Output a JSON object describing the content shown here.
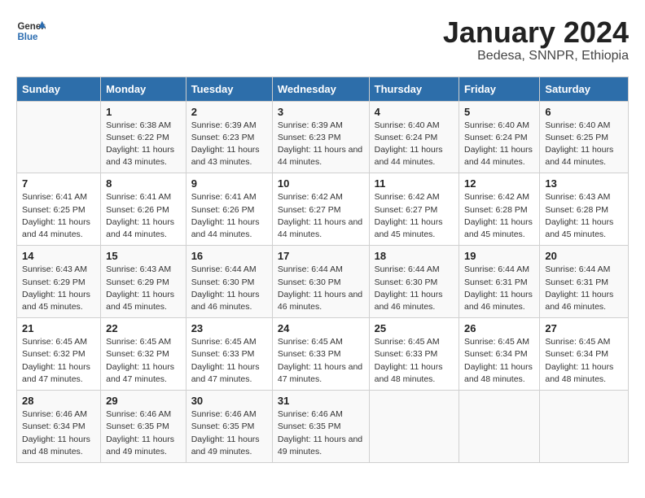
{
  "logo": {
    "text_general": "General",
    "text_blue": "Blue"
  },
  "title": "January 2024",
  "subtitle": "Bedesa, SNNPR, Ethiopia",
  "days_of_week": [
    "Sunday",
    "Monday",
    "Tuesday",
    "Wednesday",
    "Thursday",
    "Friday",
    "Saturday"
  ],
  "weeks": [
    [
      {
        "day": "",
        "sunrise": "",
        "sunset": "",
        "daylight": ""
      },
      {
        "day": "1",
        "sunrise": "Sunrise: 6:38 AM",
        "sunset": "Sunset: 6:22 PM",
        "daylight": "Daylight: 11 hours and 43 minutes."
      },
      {
        "day": "2",
        "sunrise": "Sunrise: 6:39 AM",
        "sunset": "Sunset: 6:23 PM",
        "daylight": "Daylight: 11 hours and 43 minutes."
      },
      {
        "day": "3",
        "sunrise": "Sunrise: 6:39 AM",
        "sunset": "Sunset: 6:23 PM",
        "daylight": "Daylight: 11 hours and 44 minutes."
      },
      {
        "day": "4",
        "sunrise": "Sunrise: 6:40 AM",
        "sunset": "Sunset: 6:24 PM",
        "daylight": "Daylight: 11 hours and 44 minutes."
      },
      {
        "day": "5",
        "sunrise": "Sunrise: 6:40 AM",
        "sunset": "Sunset: 6:24 PM",
        "daylight": "Daylight: 11 hours and 44 minutes."
      },
      {
        "day": "6",
        "sunrise": "Sunrise: 6:40 AM",
        "sunset": "Sunset: 6:25 PM",
        "daylight": "Daylight: 11 hours and 44 minutes."
      }
    ],
    [
      {
        "day": "7",
        "sunrise": "Sunrise: 6:41 AM",
        "sunset": "Sunset: 6:25 PM",
        "daylight": "Daylight: 11 hours and 44 minutes."
      },
      {
        "day": "8",
        "sunrise": "Sunrise: 6:41 AM",
        "sunset": "Sunset: 6:26 PM",
        "daylight": "Daylight: 11 hours and 44 minutes."
      },
      {
        "day": "9",
        "sunrise": "Sunrise: 6:41 AM",
        "sunset": "Sunset: 6:26 PM",
        "daylight": "Daylight: 11 hours and 44 minutes."
      },
      {
        "day": "10",
        "sunrise": "Sunrise: 6:42 AM",
        "sunset": "Sunset: 6:27 PM",
        "daylight": "Daylight: 11 hours and 44 minutes."
      },
      {
        "day": "11",
        "sunrise": "Sunrise: 6:42 AM",
        "sunset": "Sunset: 6:27 PM",
        "daylight": "Daylight: 11 hours and 45 minutes."
      },
      {
        "day": "12",
        "sunrise": "Sunrise: 6:42 AM",
        "sunset": "Sunset: 6:28 PM",
        "daylight": "Daylight: 11 hours and 45 minutes."
      },
      {
        "day": "13",
        "sunrise": "Sunrise: 6:43 AM",
        "sunset": "Sunset: 6:28 PM",
        "daylight": "Daylight: 11 hours and 45 minutes."
      }
    ],
    [
      {
        "day": "14",
        "sunrise": "Sunrise: 6:43 AM",
        "sunset": "Sunset: 6:29 PM",
        "daylight": "Daylight: 11 hours and 45 minutes."
      },
      {
        "day": "15",
        "sunrise": "Sunrise: 6:43 AM",
        "sunset": "Sunset: 6:29 PM",
        "daylight": "Daylight: 11 hours and 45 minutes."
      },
      {
        "day": "16",
        "sunrise": "Sunrise: 6:44 AM",
        "sunset": "Sunset: 6:30 PM",
        "daylight": "Daylight: 11 hours and 46 minutes."
      },
      {
        "day": "17",
        "sunrise": "Sunrise: 6:44 AM",
        "sunset": "Sunset: 6:30 PM",
        "daylight": "Daylight: 11 hours and 46 minutes."
      },
      {
        "day": "18",
        "sunrise": "Sunrise: 6:44 AM",
        "sunset": "Sunset: 6:30 PM",
        "daylight": "Daylight: 11 hours and 46 minutes."
      },
      {
        "day": "19",
        "sunrise": "Sunrise: 6:44 AM",
        "sunset": "Sunset: 6:31 PM",
        "daylight": "Daylight: 11 hours and 46 minutes."
      },
      {
        "day": "20",
        "sunrise": "Sunrise: 6:44 AM",
        "sunset": "Sunset: 6:31 PM",
        "daylight": "Daylight: 11 hours and 46 minutes."
      }
    ],
    [
      {
        "day": "21",
        "sunrise": "Sunrise: 6:45 AM",
        "sunset": "Sunset: 6:32 PM",
        "daylight": "Daylight: 11 hours and 47 minutes."
      },
      {
        "day": "22",
        "sunrise": "Sunrise: 6:45 AM",
        "sunset": "Sunset: 6:32 PM",
        "daylight": "Daylight: 11 hours and 47 minutes."
      },
      {
        "day": "23",
        "sunrise": "Sunrise: 6:45 AM",
        "sunset": "Sunset: 6:33 PM",
        "daylight": "Daylight: 11 hours and 47 minutes."
      },
      {
        "day": "24",
        "sunrise": "Sunrise: 6:45 AM",
        "sunset": "Sunset: 6:33 PM",
        "daylight": "Daylight: 11 hours and 47 minutes."
      },
      {
        "day": "25",
        "sunrise": "Sunrise: 6:45 AM",
        "sunset": "Sunset: 6:33 PM",
        "daylight": "Daylight: 11 hours and 48 minutes."
      },
      {
        "day": "26",
        "sunrise": "Sunrise: 6:45 AM",
        "sunset": "Sunset: 6:34 PM",
        "daylight": "Daylight: 11 hours and 48 minutes."
      },
      {
        "day": "27",
        "sunrise": "Sunrise: 6:45 AM",
        "sunset": "Sunset: 6:34 PM",
        "daylight": "Daylight: 11 hours and 48 minutes."
      }
    ],
    [
      {
        "day": "28",
        "sunrise": "Sunrise: 6:46 AM",
        "sunset": "Sunset: 6:34 PM",
        "daylight": "Daylight: 11 hours and 48 minutes."
      },
      {
        "day": "29",
        "sunrise": "Sunrise: 6:46 AM",
        "sunset": "Sunset: 6:35 PM",
        "daylight": "Daylight: 11 hours and 49 minutes."
      },
      {
        "day": "30",
        "sunrise": "Sunrise: 6:46 AM",
        "sunset": "Sunset: 6:35 PM",
        "daylight": "Daylight: 11 hours and 49 minutes."
      },
      {
        "day": "31",
        "sunrise": "Sunrise: 6:46 AM",
        "sunset": "Sunset: 6:35 PM",
        "daylight": "Daylight: 11 hours and 49 minutes."
      },
      {
        "day": "",
        "sunrise": "",
        "sunset": "",
        "daylight": ""
      },
      {
        "day": "",
        "sunrise": "",
        "sunset": "",
        "daylight": ""
      },
      {
        "day": "",
        "sunrise": "",
        "sunset": "",
        "daylight": ""
      }
    ]
  ]
}
